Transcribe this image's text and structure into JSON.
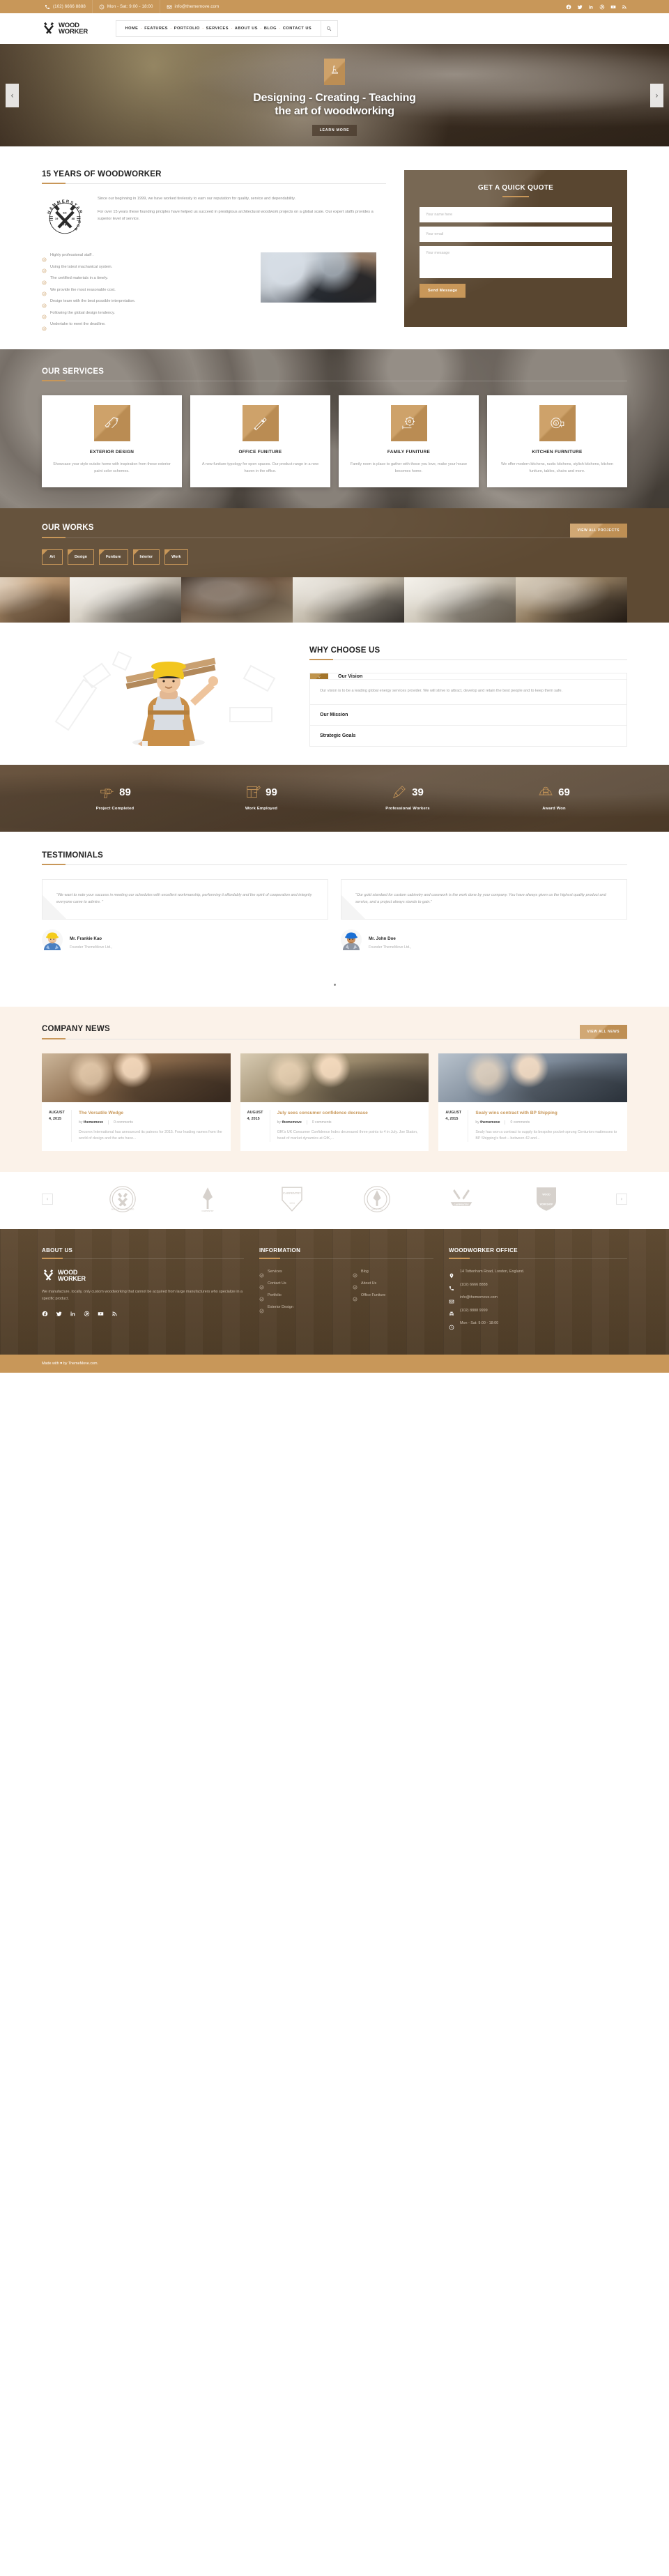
{
  "topbar": {
    "phone": "(102) 6666 8888",
    "hours": "Mon - Sat: 9:00 - 18:00",
    "email": "info@thememove.com",
    "socials": [
      "facebook-icon",
      "twitter-icon",
      "linkedin-icon",
      "dribbble-icon",
      "youtube-icon",
      "rss-icon"
    ]
  },
  "header": {
    "logo_line1": "WOOD",
    "logo_line2": "WORKER",
    "nav": [
      "HOME",
      "FEATURES",
      "PORTFOLIO",
      "SERVICES",
      "ABOUT US",
      "BLOG",
      "CONTACT US"
    ],
    "search_icon": "search-icon"
  },
  "hero": {
    "badge_icon": "hand-plane-icon",
    "title_line1": "Designing - Creating - Teaching",
    "title_line2": "the art of woodworking",
    "button": "LEARN MORE",
    "prev": "‹",
    "next": "›"
  },
  "about": {
    "title": "15 YEARS OF WOODWORKER",
    "stamp": {
      "top_text": "HAMMERSTAR",
      "bottom_text": "WOOD WORKS",
      "es": "ES",
      "year": "19",
      "year2": "88",
      "tb": "TB"
    },
    "paragraphs": [
      "Since our beginning in 1999, we have worked tirelessly to earn our reputation for quality, service and dependability.",
      "For over 15 years these founding priciples have helped us succeed in prestigious architectural woodwork projects on a global scale. Our expert staffs provides a superior level of service."
    ],
    "checklist": [
      "Highly professional staff .",
      "Using the latest machanical system.",
      "The certified materials in a timely.",
      "We provide the most reasonable cost.",
      "Design team with the best possible interpretation.",
      "Following the global design tendency.",
      "Undertake to meet the deadline."
    ]
  },
  "quote": {
    "title": "GET A QUICK QUOTE",
    "name_placeholder": "Your name here",
    "name_value": "",
    "email_placeholder": "Your email",
    "email_value": "",
    "message_placeholder": "Your message",
    "message_value": "",
    "button": "Send Message"
  },
  "services": {
    "title": "OUR SERVICES",
    "cards": [
      {
        "icon": "chainsaw-icon",
        "title": "EXTERIOR DESIGN",
        "desc": "Showcase your style outsite home with inspiration from these exterior paint color schemes."
      },
      {
        "icon": "utility-knife-icon",
        "title": "OFFICE FUNITURE",
        "desc": "A new funiture typology for open spaces. Our product range in a new haven in the office."
      },
      {
        "icon": "circular-saw-icon",
        "title": "FAMILY FUNITURE",
        "desc": "Family room is place to gather with those you love, make your house becomes home."
      },
      {
        "icon": "tape-measure-icon",
        "title": "KITCHEN FURNITURE",
        "desc": "We offer modern kitchens, rustic kitchens, stylish kitchens, kitchen funiture, tables, chairs and more."
      }
    ]
  },
  "works": {
    "title": "OUR WORKS",
    "view_all": "VIEW ALL PROJECTS",
    "filters": [
      "Art",
      "Design",
      "Funiture",
      "Interior",
      "Work"
    ],
    "gallery_count": 6
  },
  "why": {
    "title": "WHY CHOOSE US",
    "worker_alt": "carpenter-illustration",
    "accordion": [
      {
        "label": "Our Vision",
        "open": true,
        "body": "Our vision is to be a leading global energy services provider. We will strive to attract, develop and retain the best people and to keep them safe."
      },
      {
        "label": "Our Mission",
        "open": false,
        "body": ""
      },
      {
        "label": "Strategic Goals",
        "open": false,
        "body": ""
      }
    ]
  },
  "counters": [
    {
      "icon": "drill-icon",
      "number": "89",
      "label": "Project Completed"
    },
    {
      "icon": "blueprint-icon",
      "number": "99",
      "label": "Work Employed"
    },
    {
      "icon": "chisel-icon",
      "number": "39",
      "label": "Professional Workers"
    },
    {
      "icon": "hardhat-icon",
      "number": "69",
      "label": "Award Won"
    }
  ],
  "testimonials": {
    "title": "TESTIMONIALS",
    "items": [
      {
        "text": "“We want to note  your success in meeting our schedules with excellent workmanship, performing it affordably and the spirit of cooperation and integrity everyone came to admire. ”",
        "name": "Mr. Frankie Kao",
        "role": "Founder ThemeMove Ltd.,",
        "avatar": "avatar-yellow-helmet"
      },
      {
        "text": "“Our gold standard for custom cabinetry and casework is the work done by your company.  You have always given us the highest quality product and service, and a project always stands to gain.”",
        "name": "Mr. John Doe",
        "role": "Founder ThemeMove Ltd.,",
        "avatar": "avatar-blue-helmet"
      }
    ],
    "dots": 1
  },
  "news": {
    "title": "COMPANY NEWS",
    "view_all": "VIEW ALL NEWS",
    "items": [
      {
        "date": "AUGUST 4, 2015",
        "title": "The Versatile Wedge",
        "author_prefix": "by",
        "author": "thememove",
        "comments": "0 comments",
        "excerpt": "Decorex International has announced its patrons for 2015. Four leading names from the world of design and the arts have...",
        "image": "news-image-carpenters"
      },
      {
        "date": "AUGUST 4, 2015",
        "title": "July sees consumer confidence decrease",
        "author_prefix": "by",
        "author": "thememove",
        "comments": "0 comments",
        "excerpt": "GfK's UK Consumer Confidence Index decreased three points to 4 in July. Joe Staton, head of market dynamics at GfK,...",
        "image": "news-image-workshop"
      },
      {
        "date": "AUGUST 4, 2015",
        "title": "Sealy wins contract with BP Shipping",
        "author_prefix": "by",
        "author": "thememove",
        "comments": "0 comments",
        "excerpt": "Sealy has won a contract to supply its bespoke pocket-sprung Centurion mattresses to BP Shipping's fleet – between 42 and...",
        "image": "news-image-hands-wood"
      }
    ]
  },
  "brands": {
    "prev": "‹",
    "next": "›",
    "logos": [
      "brand-quality-guaranteed",
      "brand-carpentry-axe",
      "brand-carpentry-shield",
      "brand-since-2015",
      "brand-carpentry-ribbon",
      "brand-workshop-badge"
    ]
  },
  "footer": {
    "about": {
      "title": "ABOUT US",
      "logo_line1": "WOOD",
      "logo_line2": "WORKER",
      "text": "We manufacture, locally, only custom woodworking that cannot be acquired from large manufacturers who specialize in a specific product.",
      "socials": [
        "facebook-icon",
        "twitter-icon",
        "linkedin-icon",
        "dribbble-icon",
        "youtube-icon",
        "rss-icon"
      ]
    },
    "information": {
      "title": "INFORMATION",
      "col1": [
        "Services",
        "Contact Us",
        "Portfolio",
        "Exterior Design"
      ],
      "col2": [
        "Blog",
        "About Us",
        "Office Funiture"
      ]
    },
    "office": {
      "title": "WOODWORKER OFFICE",
      "address": "14 Tottenham Road, London, England.",
      "phone": "(102) 6666 8888",
      "email": "info@thememove.com",
      "fax": "(102) 8888 9999",
      "hours": "Mon - Sat: 9:00 - 18:00"
    },
    "copyright_pre": "Made with ",
    "copyright_heart": "♥",
    "copyright_post": " by ThemeMove.com."
  },
  "colors": {
    "gold": "#c89759",
    "brown": "#5e4a33",
    "dark_brown": "#4f3d28",
    "cream": "#fbf2e9",
    "text_dark": "#232323",
    "text_muted": "#9b9b9b"
  }
}
